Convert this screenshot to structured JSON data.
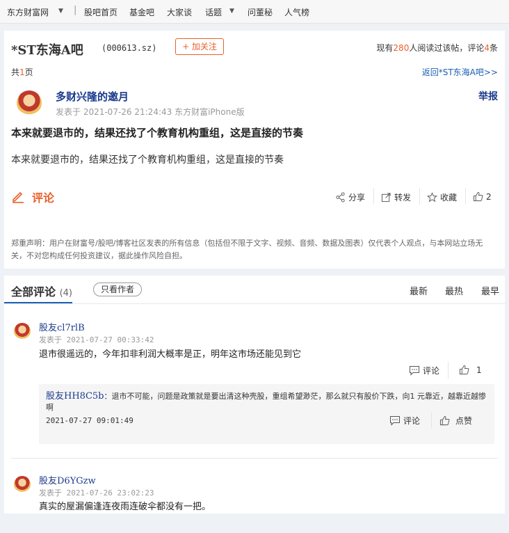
{
  "topnav": {
    "items": [
      "东方财富网",
      "股吧首页",
      "基金吧",
      "大家谈",
      "话题",
      "问董秘",
      "人气榜"
    ],
    "separator": "|"
  },
  "bar": {
    "name": "*ST东海A吧",
    "code": "(000613.sz)",
    "follow_label": "+ 加关注",
    "stats_prefix": "现有",
    "readers": "280",
    "stats_mid": "人阅读过该帖，评论",
    "comments": "4",
    "stats_suffix": "条",
    "pages_prefix": "共",
    "pages_count": "1",
    "pages_suffix": "页",
    "back_label": "返回*ST东海A吧>>"
  },
  "post": {
    "author": "多财兴隆的邀月",
    "meta": "发表于  2021-07-26 21:24:43  东方财富iPhone版",
    "report_label": "举报",
    "title": "本来就要退市的，结果还找了个教育机构重组，这是直接的节奏",
    "body": "本来就要退市的，结果还找了个教育机构重组，这是直接的节奏",
    "comment_label": "评论",
    "share_label": "分享",
    "forward_label": "转发",
    "collect_label": "收藏",
    "like_count": "2",
    "disclaimer": "郑重声明：用户在财富号/股吧/博客社区发表的所有信息（包括但不限于文字、视频、音频、数据及图表）仅代表个人观点，与本网站立场无关，不对您构成任何投资建议，据此操作风险自担。"
  },
  "comments_section": {
    "title": "全部评论",
    "count": "(4)",
    "only_author_label": "只看作者",
    "sort": {
      "latest": "最新",
      "hottest": "最热",
      "earliest": "最早"
    },
    "accent": "#e8612c",
    "items": [
      {
        "user": "股友cl7rlB",
        "time": "发表于  2021-07-27 00:33:42",
        "text": "退市很遥远的，今年扣非利润大概率是正，明年这市场还能见到它",
        "comment_label": "评论",
        "likes": "1",
        "reply": {
          "user": "股友HH8C5b",
          "text": "：退市不可能，问题是政策就是要出清这种壳股，重组希望渺茫，那么就只有股价下跌，向1  元靠近，越靠近越惨啊",
          "time": "2021-07-27 09:01:49",
          "comment_label": "评论",
          "like_label": "点赞"
        }
      },
      {
        "user": "股友D6YGzw",
        "time": "发表于  2021-07-26 23:02:23",
        "text": "真实的屋漏偏逢连夜雨连破伞都没有一把。"
      }
    ]
  }
}
